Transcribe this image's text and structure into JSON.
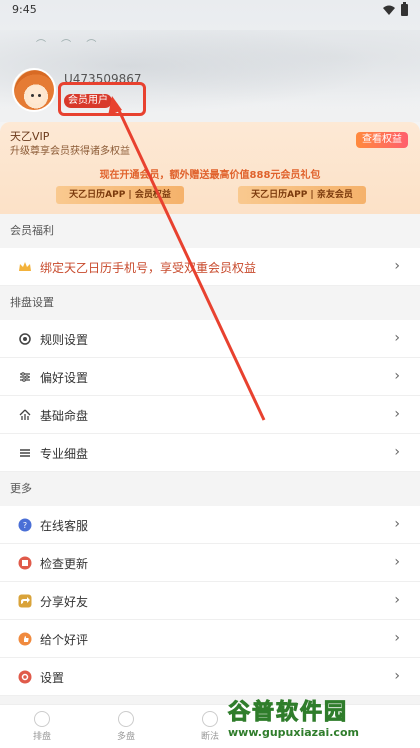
{
  "status": {
    "time": "9:45"
  },
  "profile": {
    "username": "U473509867",
    "badge": "会员用户"
  },
  "vip": {
    "title": "天乙VIP",
    "subtitle": "升级尊享会员获得诸多权益",
    "button": "查看权益",
    "promo": "现在开通会员，额外赠送最高价值888元会员礼包",
    "pill_left": "天乙日历APP | 会员权益",
    "pill_right": "天乙日历APP | 亲友会员"
  },
  "sections": {
    "benefits": {
      "label": "会员福利",
      "bind_row": "绑定天乙日历手机号，享受双重会员权益"
    },
    "chart_settings": {
      "label": "排盘设置",
      "items": [
        "规则设置",
        "偏好设置",
        "基础命盘",
        "专业细盘"
      ]
    },
    "more": {
      "label": "更多",
      "items": [
        "在线客服",
        "检查更新",
        "分享好友",
        "给个好评",
        "设置"
      ]
    }
  },
  "nav": {
    "items": [
      "排盘",
      "多盘",
      "断法"
    ]
  },
  "watermark": {
    "title": "谷普软件园",
    "url": "www.gupuxiazai.com"
  },
  "colors": {
    "accent": "#e8412f",
    "badge": "#d8392b",
    "vip_bg": "#fce1c7",
    "promo": "#e0622c"
  }
}
